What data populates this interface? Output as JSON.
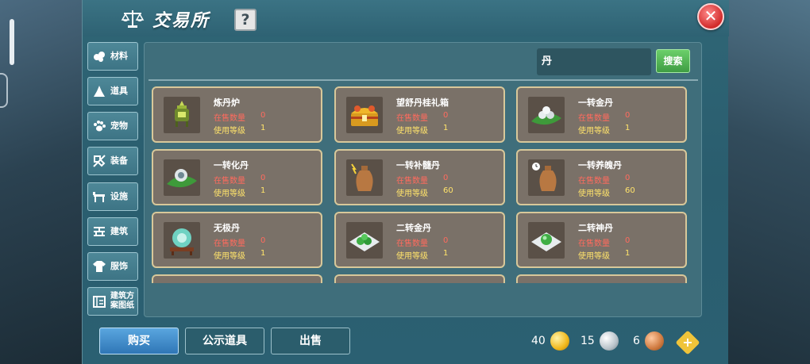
{
  "window": {
    "title": "交易所",
    "help_label": "?",
    "close_label": "✕"
  },
  "sidebar": {
    "items": [
      {
        "label": "材料",
        "icon": "materials-icon"
      },
      {
        "label": "道具",
        "icon": "props-icon"
      },
      {
        "label": "宠物",
        "icon": "paw-icon"
      },
      {
        "label": "装备",
        "icon": "equipment-icon"
      },
      {
        "label": "设施",
        "icon": "facility-icon"
      },
      {
        "label": "建筑",
        "icon": "building-icon"
      },
      {
        "label": "服饰",
        "icon": "clothing-icon"
      },
      {
        "label": "建筑方案图纸",
        "icon": "blueprint-icon"
      }
    ]
  },
  "search": {
    "value": "丹",
    "button_label": "搜索"
  },
  "item_labels": {
    "stock": "在售数量",
    "level": "使用等级"
  },
  "items": [
    {
      "name": "炼丹炉",
      "stock": "0",
      "level": "1",
      "icon": "alchemy-furnace-icon"
    },
    {
      "name": "望舒丹桂礼箱",
      "stock": "0",
      "level": "1",
      "icon": "treasure-chest-icon"
    },
    {
      "name": "一转金丹",
      "stock": "0",
      "level": "1",
      "icon": "pill-leaf-icon"
    },
    {
      "name": "一转化丹",
      "stock": "0",
      "level": "1",
      "icon": "pill-leaf-icon"
    },
    {
      "name": "一转补髓丹",
      "stock": "0",
      "level": "60",
      "icon": "vase-icon"
    },
    {
      "name": "一转养魄丹",
      "stock": "0",
      "level": "60",
      "icon": "vase-clock-icon"
    },
    {
      "name": "无极丹",
      "stock": "0",
      "level": "1",
      "icon": "orb-stand-icon"
    },
    {
      "name": "二转金丹",
      "stock": "0",
      "level": "1",
      "icon": "green-pills-icon"
    },
    {
      "name": "二转神丹",
      "stock": "0",
      "level": "1",
      "icon": "green-pill-icon"
    }
  ],
  "bottom_tabs": {
    "buy": "购买",
    "public": "公示道具",
    "sell": "出售"
  },
  "currency": {
    "gold": "40",
    "silver": "15",
    "bronze": "6",
    "add_label": "+"
  }
}
